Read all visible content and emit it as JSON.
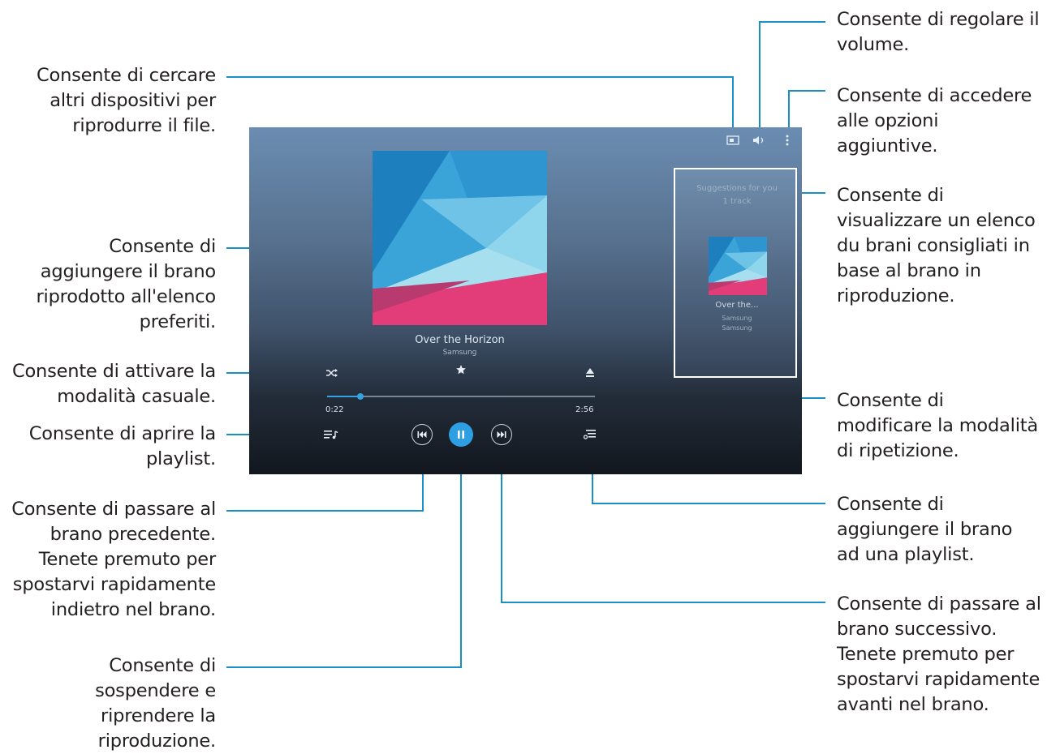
{
  "player": {
    "track_title": "Over the Horizon",
    "artist": "Samsung",
    "time_elapsed": "0:22",
    "time_total": "2:56",
    "progress_fraction": 0.125,
    "suggestions_title": "Suggestions for you\n1 track",
    "suggestion_track": "Over the...",
    "suggestion_artist": "Samsung",
    "suggestion_album": "Samsung",
    "accent_color": "#2f9fe3",
    "icons": {
      "cast": "screen-mirroring-icon",
      "volume": "volume-icon",
      "more": "more-options-icon",
      "shuffle": "shuffle-icon",
      "favorite": "star-icon",
      "repeat": "repeat-icon",
      "playlist": "playlist-icon",
      "previous": "previous-track-icon",
      "pause": "pause-icon",
      "next": "next-track-icon",
      "add_to_playlist": "add-to-playlist-icon"
    }
  },
  "callouts": {
    "search_devices": "Consente di cercare\naltri dispositivi per\nriprodurre il file.",
    "volume": "Consente di regolare il\nvolume.",
    "more_options": "Consente di accedere\nalle opzioni\naggiuntive.",
    "suggestions": "Consente di\nvisualizzare un elenco\ndu brani consigliati in\nbase al brano in\nriproduzione.",
    "favorites": "Consente di\naggiungere il brano\nriprodotto all'elenco\npreferiti.",
    "shuffle": "Consente di attivare la\nmodalità casuale.",
    "repeat": "Consente di\nmodificare la modalità\ndi ripetizione.",
    "playlist": "Consente di aprire la\nplaylist.",
    "add_to_playlist": "Consente di\naggiungere il brano\nad una playlist.",
    "previous": "Consente di passare al\nbrano precedente.\nTenete premuto per\nspostarvi rapidamente\nindietro nel brano.",
    "next": "Consente di passare al\nbrano successivo.\nTenete premuto per\nspostarvi rapidamente\navanti nel brano.",
    "pause": "Consente di\nsospendere e\nriprendere la\nriproduzione."
  }
}
